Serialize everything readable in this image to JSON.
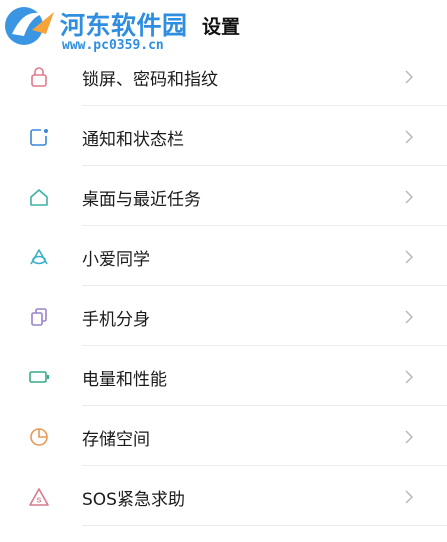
{
  "watermark": {
    "site_name": "河东软件园",
    "url": "www.pc0359.cn"
  },
  "header": {
    "title": "设置"
  },
  "settings": {
    "items": [
      {
        "label": "锁屏、密码和指纹",
        "icon": "lock-icon",
        "color": "#e07a8a"
      },
      {
        "label": "通知和状态栏",
        "icon": "notification-icon",
        "color": "#3a86d8"
      },
      {
        "label": "桌面与最近任务",
        "icon": "home-icon",
        "color": "#3bb3a6"
      },
      {
        "label": "小爱同学",
        "icon": "xiaoai-icon",
        "color": "#3cb0c9"
      },
      {
        "label": "手机分身",
        "icon": "second-space-icon",
        "color": "#9a84c8"
      },
      {
        "label": "电量和性能",
        "icon": "battery-icon",
        "color": "#33aa88"
      },
      {
        "label": "存储空间",
        "icon": "storage-icon",
        "color": "#e89a55"
      },
      {
        "label": "SOS紧急求助",
        "icon": "sos-icon",
        "color": "#d77a8c"
      }
    ]
  }
}
